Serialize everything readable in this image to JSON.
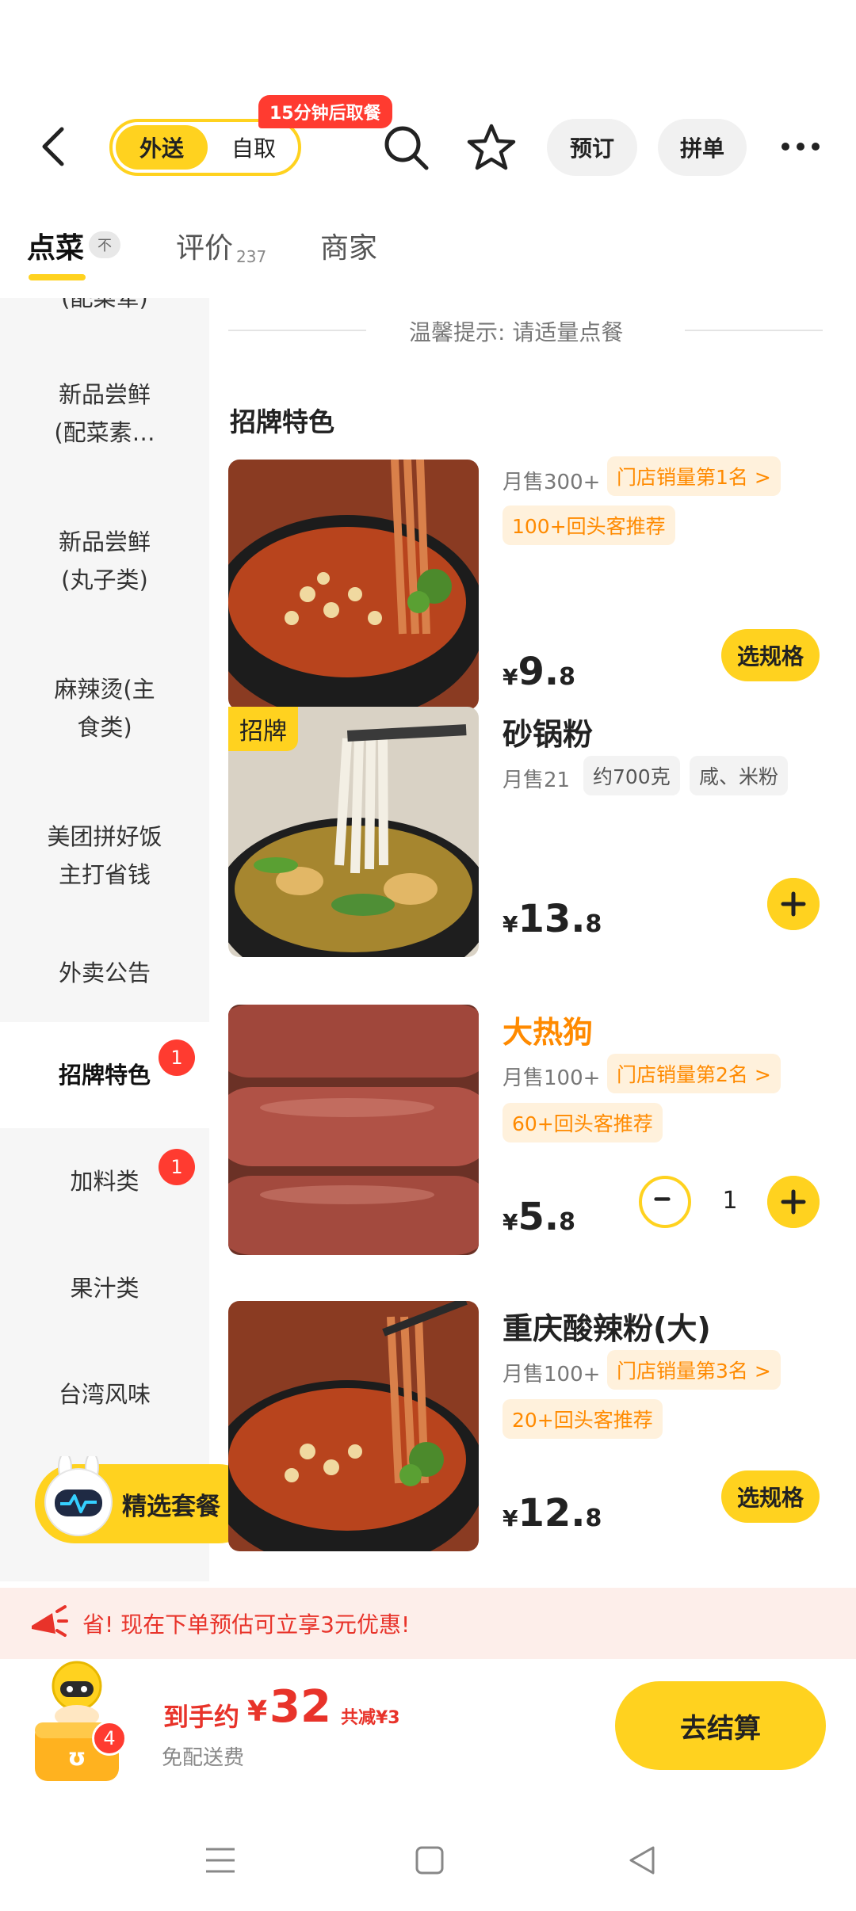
{
  "header": {
    "mode_active": "外送",
    "mode_inactive": "自取",
    "pickup_badge": "15分钟后取餐",
    "reserve_label": "预订",
    "group_label": "拼单"
  },
  "tabs": {
    "dishes": "点菜",
    "pin": "不",
    "reviews": "评价",
    "reviews_count": "237",
    "merchant": "商家"
  },
  "sidebar": {
    "items": [
      {
        "label_line1": "(配菜荤)",
        "label_line2": ""
      },
      {
        "label_line1": "新品尝鲜",
        "label_line2": "(配菜素…"
      },
      {
        "label_line1": "新品尝鲜",
        "label_line2": "(丸子类)"
      },
      {
        "label_line1": "麻辣烫(主",
        "label_line2": "食类)"
      },
      {
        "label_line1": "美团拼好饭",
        "label_line2": "主打省钱"
      },
      {
        "label_line1": "外卖公告",
        "label_line2": ""
      },
      {
        "label_line1": "招牌特色",
        "label_line2": "",
        "badge": "1"
      },
      {
        "label_line1": "加料类",
        "label_line2": "",
        "badge": "1"
      },
      {
        "label_line1": "果汁类",
        "label_line2": ""
      },
      {
        "label_line1": "台湾风味",
        "label_line2": ""
      }
    ],
    "combo_label": "精选套餐"
  },
  "main": {
    "tip": "温馨提示: 请适量点餐",
    "section_title": "招牌特色",
    "dishes": [
      {
        "name": "",
        "sales": "月售300+",
        "rank": "门店销量第1名 >",
        "repeat": "100+回头客推荐",
        "price_currency": "¥",
        "price_int": "9.",
        "price_dec": "8",
        "action": "选规格"
      },
      {
        "name": "砂锅粉",
        "sig_tag": "招牌",
        "sales": "月售21",
        "weight": "约700克",
        "taste": "咸、米粉",
        "price_currency": "¥",
        "price_int": "13.",
        "price_dec": "8"
      },
      {
        "name": "大热狗",
        "sales": "月售100+",
        "rank": "门店销量第2名 >",
        "repeat": "60+回头客推荐",
        "price_currency": "¥",
        "price_int": "5.",
        "price_dec": "8",
        "quantity": "1"
      },
      {
        "name": "重庆酸辣粉(大)",
        "sales": "月售100+",
        "rank": "门店销量第3名 >",
        "repeat": "20+回头客推荐",
        "price_currency": "¥",
        "price_int": "12.",
        "price_dec": "8",
        "action": "选规格"
      }
    ]
  },
  "promo": {
    "text": "省! 现在下单预估可立享3元优惠!"
  },
  "checkout": {
    "cart_count": "4",
    "total_label": "到手约",
    "total_currency": "¥",
    "total_amount": "32",
    "discount": "共减¥3",
    "delivery_fee": "免配送费",
    "button": "去结算"
  },
  "colors": {
    "accent": "#ffd21f",
    "badge_red": "#ff3b30",
    "promo_red": "#e8332a",
    "tag_orange": "#ff8a00"
  },
  "icons": [
    "back-arrow-icon",
    "search-icon",
    "star-icon",
    "more-dots-icon",
    "plus-icon",
    "minus-icon",
    "megaphone-icon",
    "cart-mascot-icon",
    "robot-mascot-icon",
    "menu-lines-icon",
    "home-square-icon",
    "back-triangle-icon"
  ]
}
